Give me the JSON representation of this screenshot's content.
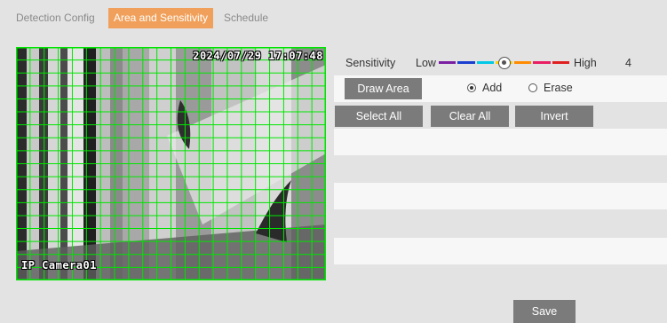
{
  "tabs": [
    {
      "label": "Detection Config",
      "active": false
    },
    {
      "label": "Area and Sensitivity",
      "active": true
    },
    {
      "label": "Schedule",
      "active": false
    }
  ],
  "video": {
    "timestamp": "2024/07/29 17:07:48",
    "camera_name": "IP Camera01",
    "grid_color": "#00e600"
  },
  "sensitivity": {
    "label": "Sensitivity",
    "low_label": "Low",
    "high_label": "High",
    "value": "4",
    "level": 4,
    "max": 8,
    "colors": [
      "#7b1fa2",
      "#1a3fd0",
      "#00c8e6",
      "#ffd400",
      "#ff8c00",
      "#e91e63",
      "#e02020"
    ]
  },
  "controls": {
    "draw_area": "Draw Area",
    "add": "Add",
    "erase": "Erase",
    "selected_mode": "add",
    "select_all": "Select All",
    "clear_all": "Clear All",
    "invert": "Invert",
    "save": "Save"
  },
  "colors": {
    "active_tab": "#f0a05a",
    "button": "#7b7b7b",
    "page_bg": "#e3e3e3",
    "row_bg": "#f7f7f7"
  }
}
